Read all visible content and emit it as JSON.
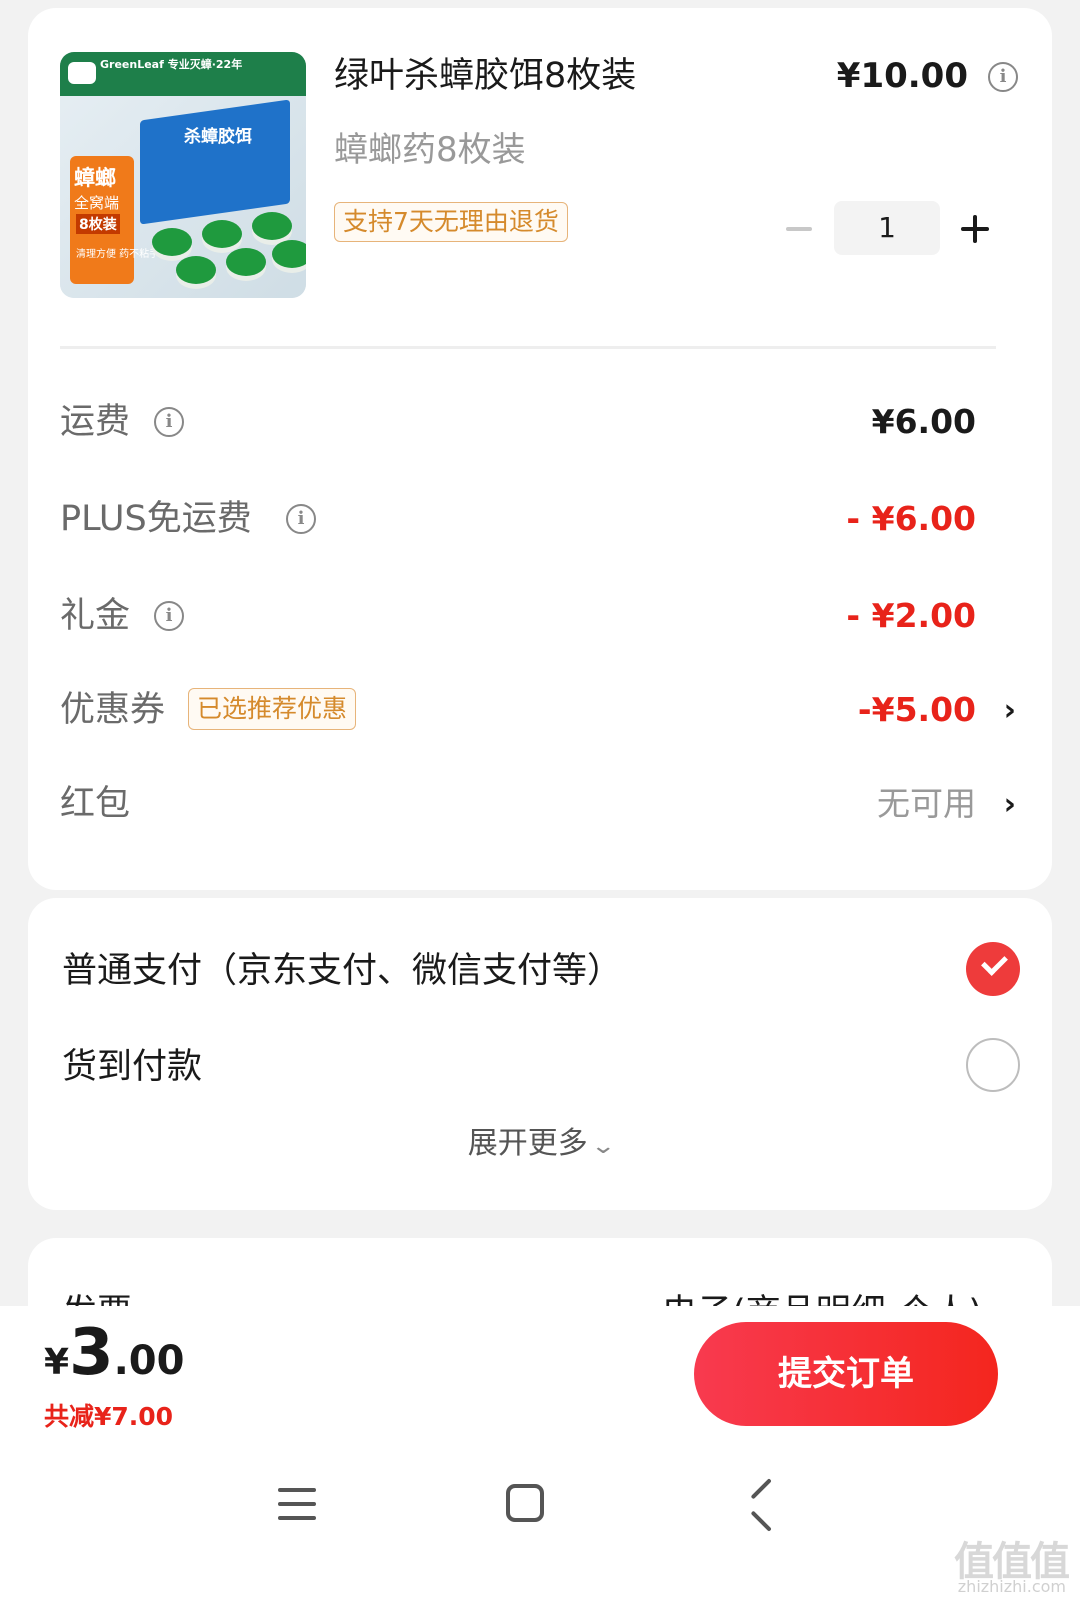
{
  "product": {
    "title": "绿叶杀蟑胶饵8枚装",
    "subtitle": "蟑螂药8枚装",
    "tag": "支持7天无理由退货",
    "price": "¥10.00",
    "quantity": "1",
    "image": {
      "brand_text": "GreenLeaf 专业灭蟑·22年",
      "box_title": "杀蟑胶饵",
      "sticker_title": "蟑螂",
      "sticker_line2": "全窝端",
      "sticker_line3": "8枚装",
      "sticker_line4": "清理方便 药不粘手"
    }
  },
  "fees": [
    {
      "label": "运费",
      "value": "¥6.00",
      "info": true
    },
    {
      "label": "PLUS免运费",
      "value": "- ¥6.00",
      "info": true
    },
    {
      "label": "礼金",
      "value": "- ¥2.00",
      "info": true
    },
    {
      "label": "优惠券",
      "tag": "已选推荐优惠",
      "value": "-¥5.00"
    },
    {
      "label": "红包",
      "value": "无可用"
    }
  ],
  "payment": {
    "options": [
      {
        "label": "普通支付（京东支付、微信支付等）",
        "selected": true
      },
      {
        "label": "货到付款",
        "selected": false
      }
    ],
    "expand_label": "展开更多"
  },
  "invoice": {
    "label": "发票",
    "value": "电子(商品明细-个人)"
  },
  "footer": {
    "currency": "¥",
    "total_int": "3",
    "total_dec": ".00",
    "saved": "共减¥7.00",
    "submit_label": "提交订单"
  },
  "watermark": {
    "glyphs": "值值值",
    "site": "zhizhizhi.com"
  },
  "colors": {
    "accent_red": "#e8231a",
    "tag_orange": "#d58a2c",
    "submit_gradient_start": "#f83a4f",
    "submit_gradient_end": "#f4261e"
  },
  "icons": {
    "info": "info-icon",
    "chevron": "chevron-right-icon",
    "check": "check-icon"
  }
}
